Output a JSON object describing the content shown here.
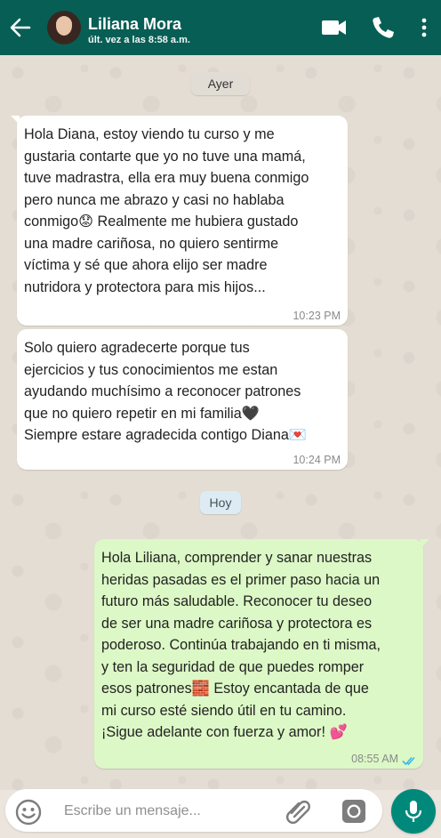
{
  "header": {
    "contact_name": "Liliana Mora",
    "last_seen": "últ. vez a las 8:58 a.m.",
    "icons": [
      "back-arrow-icon",
      "video-call-icon",
      "phone-icon",
      "more-vert-icon"
    ],
    "background_color": "#075e54"
  },
  "chat": {
    "date_ayer": "Ayer",
    "date_hoy": "Hoy",
    "messages": [
      {
        "direction": "incoming",
        "text": "Hola Diana, estoy viendo tu curso y me\ngustaria contarte que yo no tuve una mamá,\ntuve madrastra, ella era muy buena conmigo\npero nunca me abrazo y casi no hablaba\nconmigo😟 Realmente me hubiera gustado\nuna madre cariñosa, no quiero sentirme\nvíctima y sé que ahora elijo ser madre\nnutridora y protectora para mis hijos...",
        "time": "10:23 PM"
      },
      {
        "direction": "incoming",
        "text": "Solo quiero agradecerte porque tus\nejercicios y tus conocimientos me estan\nayudando muchísimo a reconocer patrones\nque no quiero repetir en mi familia🖤\nSiempre estare agradecida contigo Diana💌",
        "time": "10:24 PM"
      },
      {
        "direction": "outgoing",
        "text": "Hola Liliana, comprender y sanar nuestras\nheridas pasadas es el primer paso hacia un\nfuturo más saludable. Reconocer tu deseo\nde ser una madre cariñosa y protectora es\npoderoso. Continúa trabajando en ti misma,\ny ten la seguridad de que puedes romper\nesos patrones🧱 Estoy encantada de que\nmi curso esté siendo útil en tu camino.\n¡Sigue adelante con fuerza y amor! 💕",
        "time": "08:55 AM",
        "status": "read"
      }
    ],
    "colors": {
      "incoming_bubble": "#ffffff",
      "outgoing_bubble": "#dcf8c6",
      "read_ticks": "#34b7f1"
    }
  },
  "composer": {
    "placeholder": "Escribe un mensaje...",
    "icons": [
      "emoji-icon",
      "paperclip-icon",
      "camera-icon",
      "mic-icon"
    ],
    "mic_color": "#00897b"
  }
}
